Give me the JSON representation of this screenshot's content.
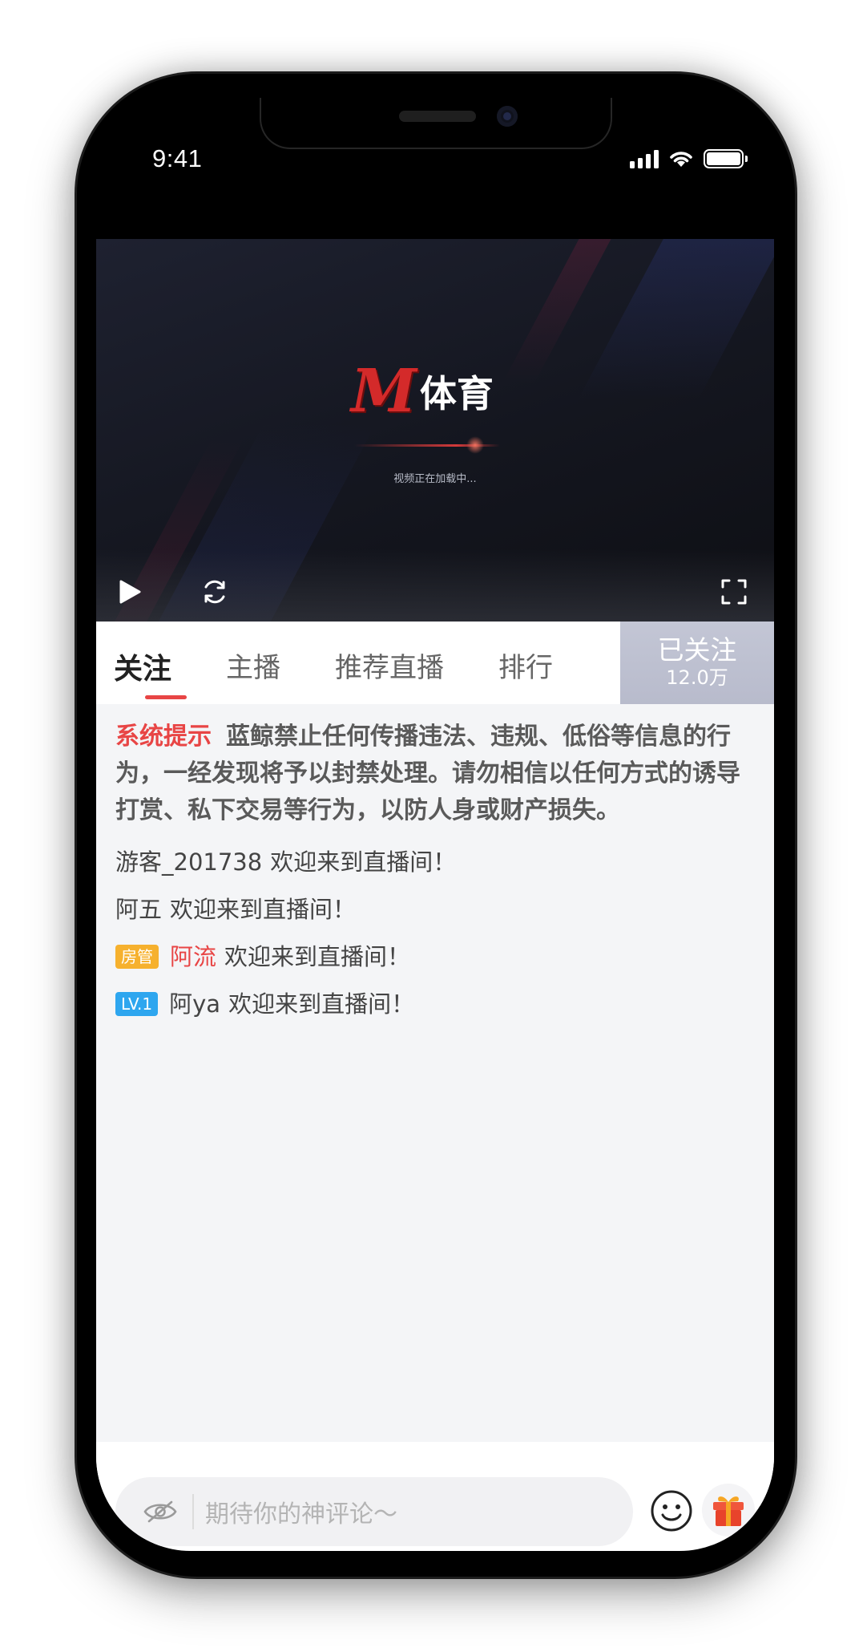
{
  "status_bar": {
    "time": "9:41"
  },
  "video": {
    "logo_text": "体育",
    "logo_mark": "M",
    "loading_text": "视频正在加载中..."
  },
  "tabs": {
    "items": [
      "关注",
      "主播",
      "推荐直播",
      "排行"
    ],
    "active_index": 0,
    "follow_label": "已关注",
    "follow_count": "12.0万"
  },
  "chat": {
    "notice": {
      "tag": "系统提示",
      "text": "蓝鲸禁止任何传播违法、违规、低俗等信息的行为，一经发现将予以封禁处理。请勿相信以任何方式的诱导打赏、私下交易等行为，以防人身或财产损失。"
    },
    "messages": [
      {
        "user": "游客_201738",
        "text": "欢迎来到直播间！",
        "badge": ""
      },
      {
        "user": "阿五",
        "text": "欢迎来到直播间！",
        "badge": ""
      },
      {
        "user": "阿流",
        "text": "欢迎来到直播间！",
        "badge": "房管"
      },
      {
        "user": "阿ya",
        "text": "欢迎来到直播间！",
        "badge": "LV.1"
      }
    ]
  },
  "composer": {
    "placeholder": "期待你的神评论～",
    "icons": [
      "eye-icon",
      "emoji-icon",
      "gift-icon"
    ]
  },
  "colors": {
    "accent": "#e84545",
    "admin_badge": "#f6b12e",
    "level_badge": "#2ea6ef",
    "follow_button": "#bcbfcf",
    "chat_bg": "#f4f5f7"
  }
}
